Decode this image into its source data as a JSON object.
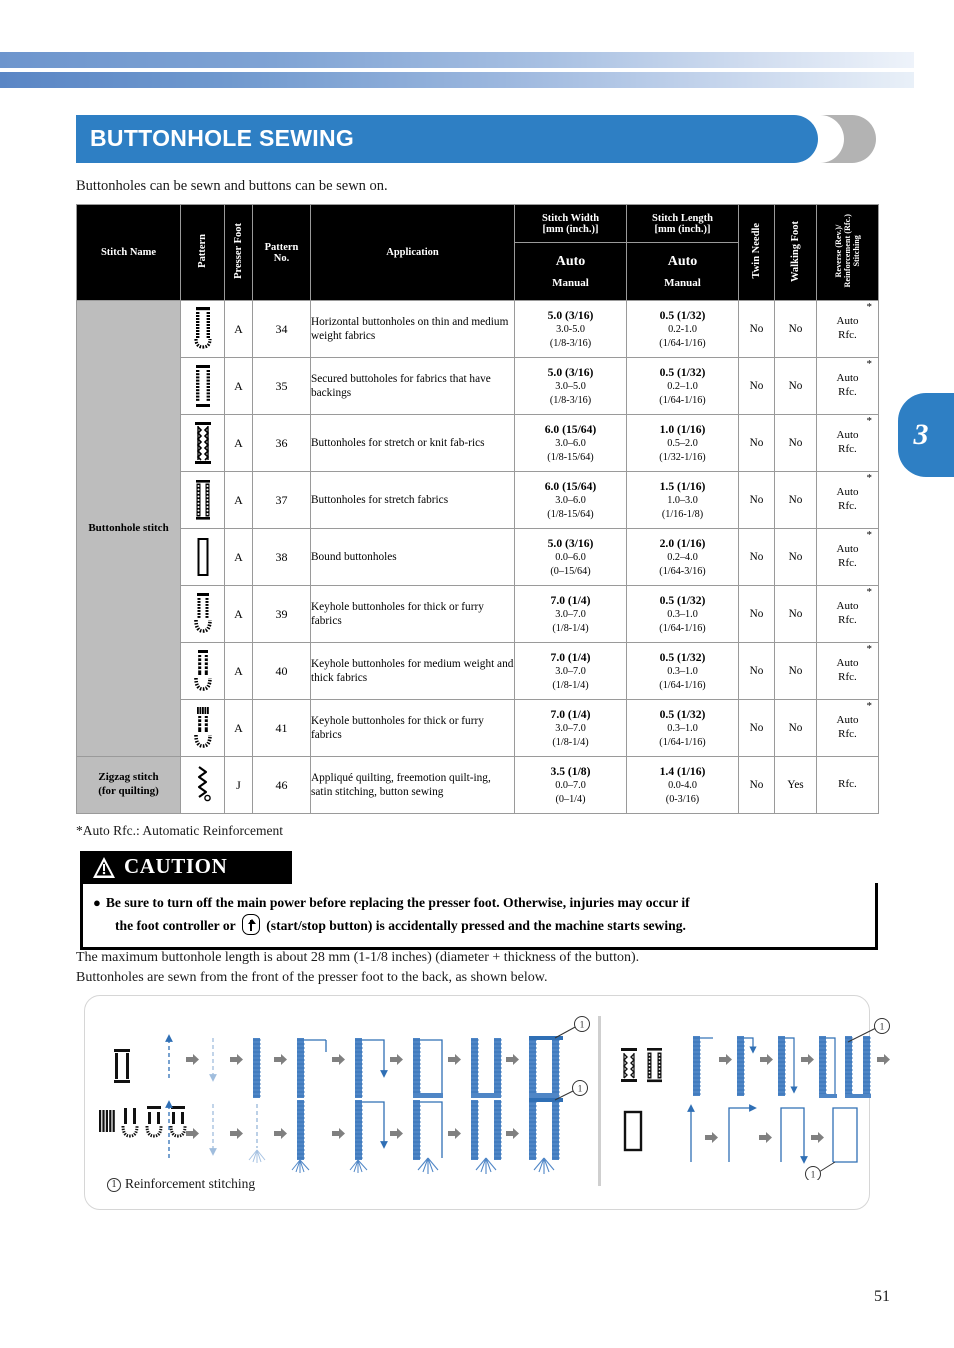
{
  "page": {
    "number": "51",
    "chapter_tab": "3"
  },
  "header": {
    "title": "BUTTONHOLE SEWING",
    "intro": "Buttonholes can be sewn and buttons can be sewn on."
  },
  "table": {
    "columns": {
      "stitch_name": "Stitch Name",
      "pattern": "Pattern",
      "presser_foot": "Presser Foot",
      "pattern_no": "Pattern\nNo.",
      "pattern_no_line1": "Pattern",
      "pattern_no_line2": "No.",
      "application": "Application",
      "stitch_width_line1": "Stitch Width",
      "stitch_width_line2": "[mm (inch.)]",
      "stitch_length_line1": "Stitch Length",
      "stitch_length_line2": "[mm (inch.)]",
      "auto": "Auto",
      "manual": "Manual",
      "twin_needle": "Twin Needle",
      "walking_foot": "Walking  Foot",
      "reverse_line1": "Reverse (Rev.)/",
      "reverse_line2": "Reinforcement (Rfc.)",
      "reverse_line3": "Stitching"
    },
    "groups": [
      {
        "label": "Buttonhole stitch",
        "rowspan": 8
      },
      {
        "label_line1": "Zigzag stitch",
        "label_line2": "(for quilting)",
        "rowspan": 1
      }
    ],
    "rows": [
      {
        "glyph": "buttonhole-round-end",
        "presser_foot": "A",
        "pattern_no": "34",
        "application": "Horizontal buttonholes on thin and medium weight fabrics",
        "width_auto": "5.0 (3/16)",
        "width_manual_mm": "3.0-5.0",
        "width_manual_in": "(1/8-3/16)",
        "length_auto": "0.5 (1/32)",
        "length_manual_mm": "0.2-1.0",
        "length_manual_in": "(1/64-1/16)",
        "twin_needle": "No",
        "walking_foot": "No",
        "reverse_line1": "Auto",
        "reverse_line2": "Rfc.",
        "star": "*"
      },
      {
        "glyph": "buttonhole-secured",
        "presser_foot": "A",
        "pattern_no": "35",
        "application": "Secured buttoholes for fabrics that have backings",
        "width_auto": "5.0 (3/16)",
        "width_manual_mm": "3.0–5.0",
        "width_manual_in": "(1/8-3/16)",
        "length_auto": "0.5 (1/32)",
        "length_manual_mm": "0.2–1.0",
        "length_manual_in": "(1/64-1/16)",
        "twin_needle": "No",
        "walking_foot": "No",
        "reverse_line1": "Auto",
        "reverse_line2": "Rfc.",
        "star": "*"
      },
      {
        "glyph": "buttonhole-stretch-zig",
        "presser_foot": "A",
        "pattern_no": "36",
        "application": "Buttonholes for stretch or knit fab-rics",
        "width_auto": "6.0 (15/64)",
        "width_manual_mm": "3.0–6.0",
        "width_manual_in": "(1/8-15/64)",
        "length_auto": "1.0 (1/16)",
        "length_manual_mm": "0.5–2.0",
        "length_manual_in": "(1/32-1/16)",
        "twin_needle": "No",
        "walking_foot": "No",
        "reverse_line1": "Auto",
        "reverse_line2": "Rfc.",
        "star": "*"
      },
      {
        "glyph": "buttonhole-stretch-dense",
        "presser_foot": "A",
        "pattern_no": "37",
        "application": "Buttonholes for stretch fabrics",
        "width_auto": "6.0 (15/64)",
        "width_manual_mm": "3.0–6.0",
        "width_manual_in": "(1/8-15/64)",
        "length_auto": "1.5 (1/16)",
        "length_manual_mm": "1.0–3.0",
        "length_manual_in": "(1/16-1/8)",
        "twin_needle": "No",
        "walking_foot": "No",
        "reverse_line1": "Auto",
        "reverse_line2": "Rfc.",
        "star": "*"
      },
      {
        "glyph": "buttonhole-bound",
        "presser_foot": "A",
        "pattern_no": "38",
        "application": "Bound buttonholes",
        "width_auto": "5.0 (3/16)",
        "width_manual_mm": "0.0–6.0",
        "width_manual_in": "(0–15/64)",
        "length_auto": "2.0 (1/16)",
        "length_manual_mm": "0.2–4.0",
        "length_manual_in": "(1/64-3/16)",
        "twin_needle": "No",
        "walking_foot": "No",
        "reverse_line1": "Auto",
        "reverse_line2": "Rfc.",
        "star": "*"
      },
      {
        "glyph": "keyhole-thick",
        "presser_foot": "A",
        "pattern_no": "39",
        "application": "Keyhole buttonholes for thick or furry fabrics",
        "width_auto": "7.0 (1/4)",
        "width_manual_mm": "3.0–7.0",
        "width_manual_in": "(1/8-1/4)",
        "length_auto": "0.5 (1/32)",
        "length_manual_mm": "0.3–1.0",
        "length_manual_in": "(1/64-1/16)",
        "twin_needle": "No",
        "walking_foot": "No",
        "reverse_line1": "Auto",
        "reverse_line2": "Rfc.",
        "star": "*"
      },
      {
        "glyph": "keyhole-medium",
        "presser_foot": "A",
        "pattern_no": "40",
        "application": "Keyhole buttonholes for medium weight and thick fabrics",
        "width_auto": "7.0 (1/4)",
        "width_manual_mm": "3.0–7.0",
        "width_manual_in": "(1/8-1/4)",
        "length_auto": "0.5 (1/32)",
        "length_manual_mm": "0.3–1.0",
        "length_manual_in": "(1/64-1/16)",
        "twin_needle": "No",
        "walking_foot": "No",
        "reverse_line1": "Auto",
        "reverse_line2": "Rfc.",
        "star": "*"
      },
      {
        "glyph": "keyhole-furry",
        "presser_foot": "A",
        "pattern_no": "41",
        "application": "Keyhole buttonholes for thick or furry fabrics",
        "width_auto": "7.0 (1/4)",
        "width_manual_mm": "3.0–7.0",
        "width_manual_in": "(1/8-1/4)",
        "length_auto": "0.5 (1/32)",
        "length_manual_mm": "0.3–1.0",
        "length_manual_in": "(1/64-1/16)",
        "twin_needle": "No",
        "walking_foot": "No",
        "reverse_line1": "Auto",
        "reverse_line2": "Rfc.",
        "star": "*"
      },
      {
        "glyph": "zigzag-quilting",
        "presser_foot": "J",
        "pattern_no": "46",
        "application": "Appliqué quilting, freemotion quilt-ing, satin stitching, button sewing",
        "width_auto": "3.5 (1/8)",
        "width_manual_mm": "0.0–7.0",
        "width_manual_in": "(0–1/4)",
        "length_auto": "1.4 (1/16)",
        "length_manual_mm": "0.0-4.0",
        "length_manual_in": "(0-3/16)",
        "twin_needle": "No",
        "walking_foot": "Yes",
        "reverse_line1": "Rfc.",
        "reverse_line2": "",
        "star": ""
      }
    ]
  },
  "footnote": "*Auto Rfc.: Automatic Reinforcement",
  "caution": {
    "label": "CAUTION",
    "line1": "Be sure to turn off the main power before replacing the presser foot. Otherwise, injuries may occur if",
    "line2_before": "the foot controller or",
    "line2_after": "(start/stop button) is accidentally pressed and the machine starts sewing."
  },
  "paragraph": {
    "line1": "The maximum buttonhole length is about 28 mm (1-1/8 inches) (diameter + thickness of the button).",
    "line2": "Buttonholes are sewn from the front of the presser foot to the back, as shown below."
  },
  "diagram": {
    "caption": "Reinforcement stitching",
    "caption_marker": "1",
    "markers": [
      "1",
      "1",
      "1",
      "1"
    ]
  },
  "colors": {
    "accent_blue": "#2E7FC4",
    "stitch_blue": "#3D78BE",
    "arrow_gray": "#808080",
    "group_gray": "#BDBDBD",
    "header_black": "#000000"
  }
}
